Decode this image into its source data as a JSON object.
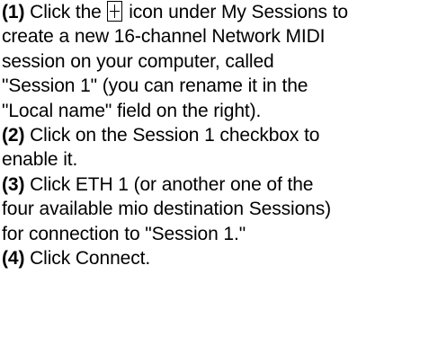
{
  "steps": [
    {
      "number": "(1)",
      "lines": [
        {
          "before_icon": "Click the ",
          "icon": "plus-icon",
          "after_icon": " icon under My Sessions to"
        },
        "create a new 16-channel Network MIDI",
        "session on your computer, called",
        "\"Session 1\" (you can rename it in the",
        "\"Local name\" field on the right)."
      ]
    },
    {
      "number": "(2)",
      "lines": [
        " Click on the Session 1 checkbox to",
        "enable it."
      ]
    },
    {
      "number": "(3)",
      "lines": [
        " Click ETH 1 (or another one of the",
        "four available mio destination Sessions)",
        "for connection to \"Session 1.\""
      ]
    },
    {
      "number": "(4)",
      "lines": [
        " Click Connect."
      ]
    }
  ]
}
